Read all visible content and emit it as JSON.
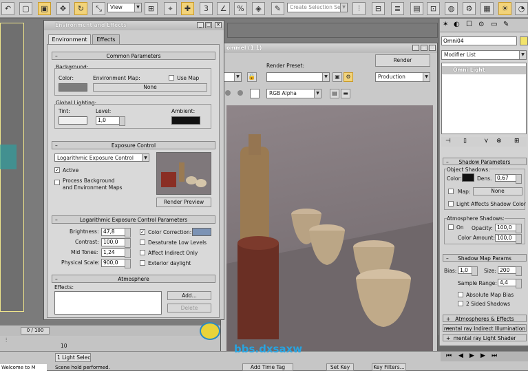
{
  "toolbar": {
    "view_label": "View",
    "selection_set_placeholder": "Create Selection Se",
    "icons": [
      "undo-icon",
      "select-icon",
      "region-icon",
      "move-icon",
      "rotate-icon",
      "scale-icon",
      "snap-icon",
      "mirror-icon",
      "align-icon",
      "layer-icon",
      "curve-icon",
      "schematic-icon",
      "material-icon",
      "render-setup-icon",
      "render-frame-icon",
      "quick-render-icon"
    ]
  },
  "env_dialog": {
    "title": "Environment and Effects",
    "tabs": [
      "Environment",
      "Effects"
    ],
    "common": {
      "header": "Common Parameters",
      "background_label": "Background:",
      "color_label": "Color:",
      "env_map_label": "Environment Map:",
      "use_map_label": "Use Map",
      "none_label": "None",
      "global_lighting_label": "Global Lighting:",
      "tint_label": "Tint:",
      "level_label": "Level:",
      "level_value": "1,0",
      "ambient_label": "Ambient:",
      "bg_color": "#7c7c7c",
      "ambient_color": "#111111"
    },
    "exposure": {
      "header": "Exposure Control",
      "type": "Logarithmic Exposure Control",
      "active_label": "Active",
      "process_bg_label_1": "Process Background",
      "process_bg_label_2": "and Environment Maps",
      "render_preview_label": "Render Preview"
    },
    "log_params": {
      "header": "Logarithmic Exposure Control Parameters",
      "brightness_label": "Brightness:",
      "brightness": "47,8",
      "contrast_label": "Contrast:",
      "contrast": "100,0",
      "midtones_label": "Mid Tones:",
      "midtones": "1,24",
      "phys_scale_label": "Physical Scale:",
      "phys_scale": "900,0",
      "color_corr_label": "Color Correction:",
      "desaturate_label": "Desaturate Low Levels",
      "affect_indirect_label": "Affect Indirect Only",
      "exterior_label": "Exterior daylight",
      "corr_color": "#7c93b5"
    },
    "atmosphere": {
      "header": "Atmosphere",
      "effects_label": "Effects:",
      "add_label": "Add...",
      "delete_label": "Delete"
    }
  },
  "render_window": {
    "title": "Omni04, frame 0, Camera01 (1:1)",
    "title_visible": "ommel (1:1)",
    "render_preset_label": "Render Preset:",
    "render_label": "Render",
    "production_label": "Production",
    "channel": "RGB Alpha"
  },
  "command_panel": {
    "object_name": "Omni04",
    "modifier_list_label": "Modifier List",
    "stack_item": "Omni Light",
    "shadow_params": {
      "header": "Shadow Parameters",
      "object_shadows_label": "Object Shadows:",
      "color_label": "Color:",
      "dens_label": "Dens.",
      "dens": "0,67",
      "map_label": "Map:",
      "none_label": "None",
      "light_affects_label": "Light Affects Shadow Color",
      "atmo_shadows_label": "Atmosphere Shadows:",
      "on_label": "On",
      "opacity_label": "Opacity:",
      "opacity": "100,0",
      "color_amount_label": "Color Amount:",
      "color_amount": "100,0"
    },
    "shadow_map": {
      "header": "Shadow Map Params",
      "bias_label": "Bias:",
      "bias": "1,0",
      "size_label": "Size:",
      "size": "200",
      "sample_range_label": "Sample Range:",
      "sample_range": "4,4",
      "absolute_bias_label": "Absolute Map Bias",
      "two_sided_label": "2 Sided Shadows"
    },
    "collapsed": [
      "Atmospheres & Effects",
      "mental ray Indirect Illumination",
      "mental ray Light Shader"
    ]
  },
  "timeline": {
    "frame_label": "0 / 100",
    "tick_label": "10"
  },
  "status": {
    "welcome": "Welcome to M",
    "light_selected": "1 Light Selec",
    "rendering": "Scene hold performed.",
    "add_time_tag": "Add Time Tag",
    "set_key": "Set Key",
    "key_filters": "Key Filters..."
  },
  "watermark": {
    "text": "bbs.dxsaxw"
  }
}
